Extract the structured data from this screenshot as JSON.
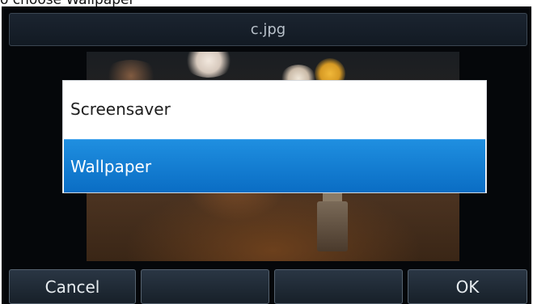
{
  "caption": "o choose Wallpaper",
  "title_bar": {
    "title": "c.jpg"
  },
  "popup": {
    "items": [
      {
        "label": "Screensaver",
        "selected": false
      },
      {
        "label": "Wallpaper",
        "selected": true
      }
    ]
  },
  "softkeys": [
    {
      "label": "Cancel"
    },
    {
      "label": ""
    },
    {
      "label": ""
    },
    {
      "label": "OK"
    }
  ],
  "colors": {
    "selection": "#0f78d0",
    "screen_background": "#05070a"
  }
}
